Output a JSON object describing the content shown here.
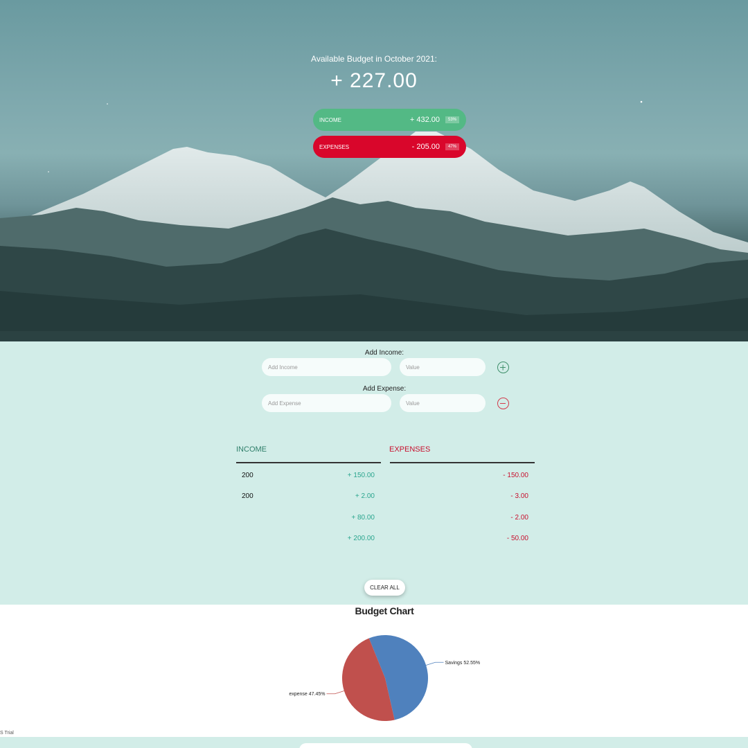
{
  "header": {
    "title": "Available Budget in October 2021:",
    "budget": "+ 227.00",
    "income": {
      "label": "INCOME",
      "value": "+ 432.00",
      "percent": "53%"
    },
    "expenses": {
      "label": "EXPENSES",
      "value": "- 205.00",
      "percent": "47%"
    }
  },
  "form": {
    "income_label": "Add Income:",
    "income_desc_placeholder": "Add Income",
    "income_value_placeholder": "Value",
    "expense_label": "Add Expense:",
    "expense_desc_placeholder": "Add Expense",
    "expense_value_placeholder": "Value",
    "add_icon": "plus-circle-icon",
    "remove_icon": "minus-circle-icon"
  },
  "lists": {
    "income_header": "INCOME",
    "expenses_header": "EXPENSES",
    "income_items": [
      {
        "name": "200",
        "value": "+ 150.00"
      },
      {
        "name": "200",
        "value": "+ 2.00"
      },
      {
        "name": "",
        "value": "+ 80.00"
      },
      {
        "name": "",
        "value": "+ 200.00"
      }
    ],
    "expense_items": [
      {
        "name": "",
        "value": "- 150.00"
      },
      {
        "name": "",
        "value": "- 3.00"
      },
      {
        "name": "",
        "value": "- 2.00"
      },
      {
        "name": "",
        "value": "- 50.00"
      }
    ],
    "clear_button": "CLEAR ALL"
  },
  "colors": {
    "income": "#53b985",
    "expense": "#d9062b",
    "income_text": "#2aa58e",
    "expense_text": "#c8102e",
    "background": "#d2ede8"
  },
  "chart_data": {
    "type": "pie",
    "title": "Budget Chart",
    "slices": [
      {
        "label": "Savings 52.55%",
        "value": 52.55,
        "color": "#4f81bd"
      },
      {
        "label": "expense 47.45%",
        "value": 47.45,
        "color": "#c0504d"
      }
    ]
  },
  "footer": {
    "trial_text": "S Trial"
  }
}
